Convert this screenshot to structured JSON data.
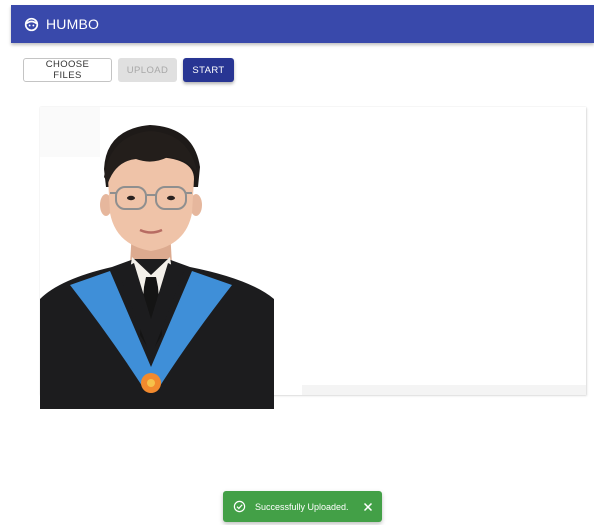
{
  "app": {
    "title": "HUMBO",
    "logo_icon": "face-icon",
    "bar_color": "#3949ab"
  },
  "toolbar": {
    "choose_files_label": "CHOOSE FILES",
    "upload_label": "UPLOAD",
    "upload_disabled": true,
    "start_label": "START",
    "start_color": "#283593"
  },
  "preview": {
    "image_alt": "Uploaded portrait photo"
  },
  "snackbar": {
    "message": "Successfully Uploaded.",
    "status_icon": "check-circle-icon",
    "close_icon": "close-icon",
    "color": "#43a047"
  }
}
